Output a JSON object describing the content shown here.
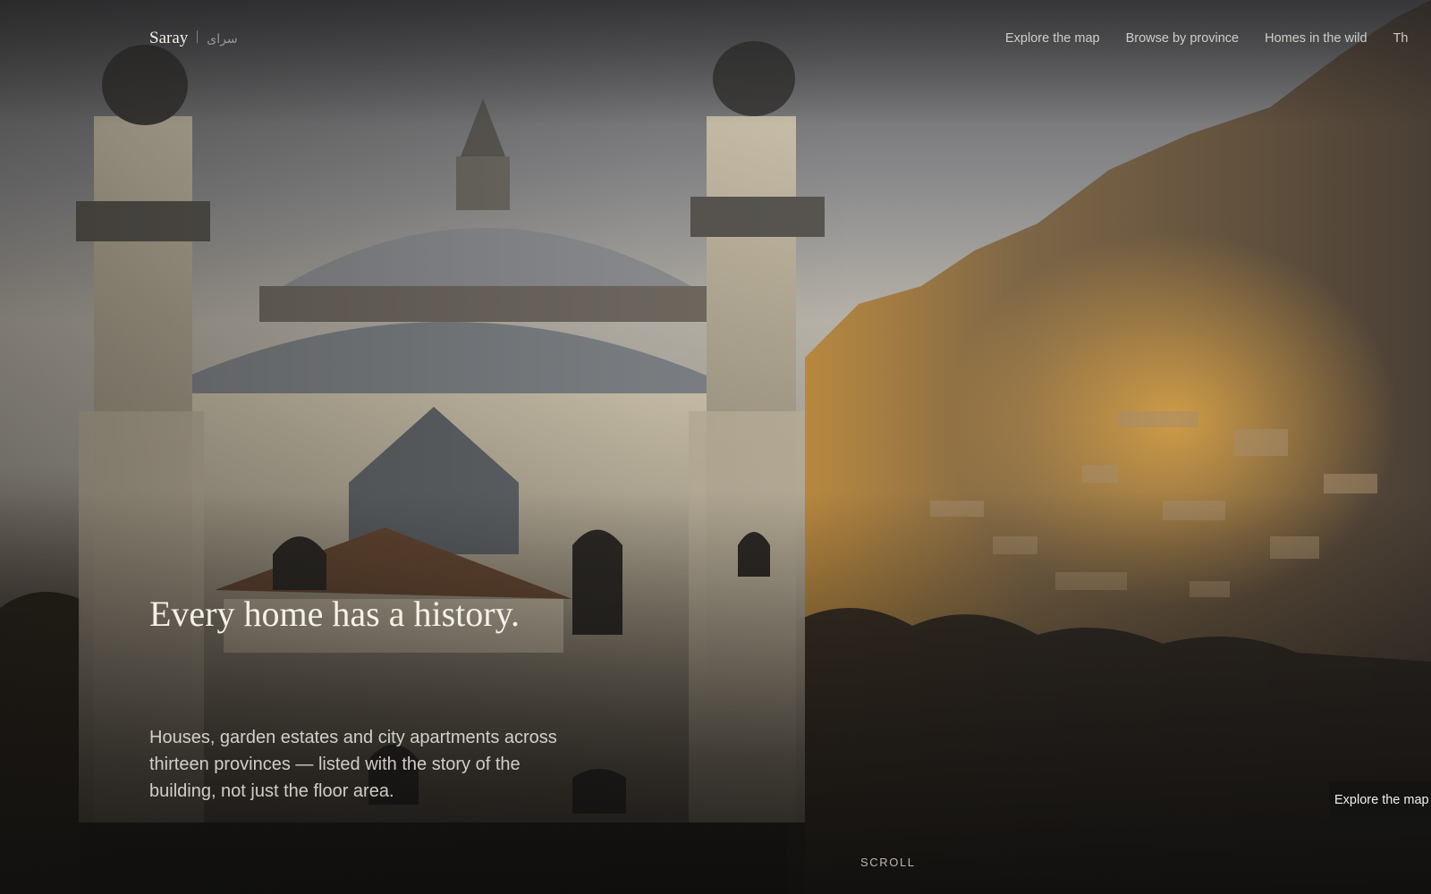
{
  "brand": {
    "name": "Saray",
    "alt_script": "سرای"
  },
  "nav": {
    "links": [
      {
        "label": "Explore the map"
      },
      {
        "label": "Browse by province"
      },
      {
        "label": "Homes in the wild"
      },
      {
        "label": "Th"
      }
    ]
  },
  "hero": {
    "headline": "Every home has a history.",
    "lede": "Houses, garden estates and city apartments across thirteen provinces — listed with the story of the building, not just the floor area.",
    "cta_label": "Explore the map",
    "scroll_label": "SCROLL"
  },
  "colors": {
    "text_primary": "#f6f1e8",
    "button_bg": "#141312",
    "hillside_glow": "#d89a3a"
  }
}
